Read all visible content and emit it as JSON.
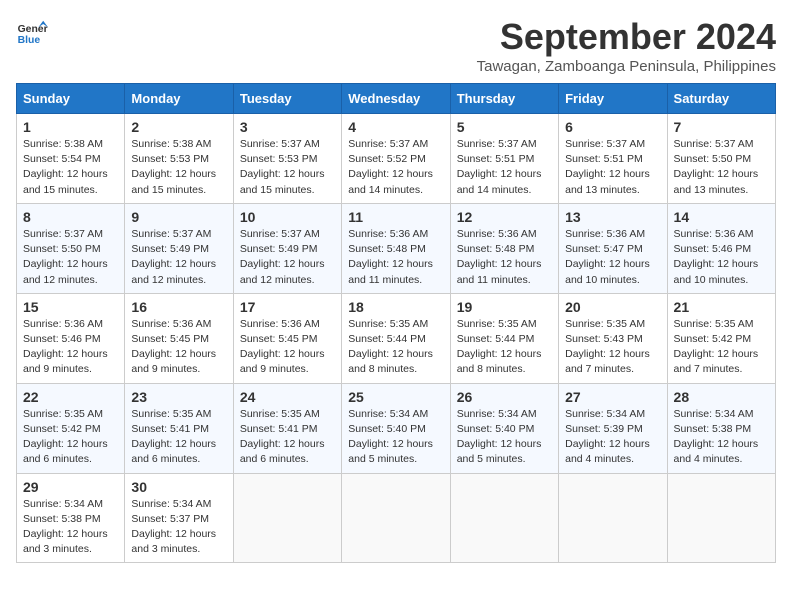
{
  "header": {
    "logo_line1": "General",
    "logo_line2": "Blue",
    "month_title": "September 2024",
    "subtitle": "Tawagan, Zamboanga Peninsula, Philippines"
  },
  "weekdays": [
    "Sunday",
    "Monday",
    "Tuesday",
    "Wednesday",
    "Thursday",
    "Friday",
    "Saturday"
  ],
  "weeks": [
    [
      {
        "day": "1",
        "sunrise": "5:38 AM",
        "sunset": "5:54 PM",
        "daylight": "12 hours and 15 minutes."
      },
      {
        "day": "2",
        "sunrise": "5:38 AM",
        "sunset": "5:53 PM",
        "daylight": "12 hours and 15 minutes."
      },
      {
        "day": "3",
        "sunrise": "5:37 AM",
        "sunset": "5:53 PM",
        "daylight": "12 hours and 15 minutes."
      },
      {
        "day": "4",
        "sunrise": "5:37 AM",
        "sunset": "5:52 PM",
        "daylight": "12 hours and 14 minutes."
      },
      {
        "day": "5",
        "sunrise": "5:37 AM",
        "sunset": "5:51 PM",
        "daylight": "12 hours and 14 minutes."
      },
      {
        "day": "6",
        "sunrise": "5:37 AM",
        "sunset": "5:51 PM",
        "daylight": "12 hours and 13 minutes."
      },
      {
        "day": "7",
        "sunrise": "5:37 AM",
        "sunset": "5:50 PM",
        "daylight": "12 hours and 13 minutes."
      }
    ],
    [
      {
        "day": "8",
        "sunrise": "5:37 AM",
        "sunset": "5:50 PM",
        "daylight": "12 hours and 12 minutes."
      },
      {
        "day": "9",
        "sunrise": "5:37 AM",
        "sunset": "5:49 PM",
        "daylight": "12 hours and 12 minutes."
      },
      {
        "day": "10",
        "sunrise": "5:37 AM",
        "sunset": "5:49 PM",
        "daylight": "12 hours and 12 minutes."
      },
      {
        "day": "11",
        "sunrise": "5:36 AM",
        "sunset": "5:48 PM",
        "daylight": "12 hours and 11 minutes."
      },
      {
        "day": "12",
        "sunrise": "5:36 AM",
        "sunset": "5:48 PM",
        "daylight": "12 hours and 11 minutes."
      },
      {
        "day": "13",
        "sunrise": "5:36 AM",
        "sunset": "5:47 PM",
        "daylight": "12 hours and 10 minutes."
      },
      {
        "day": "14",
        "sunrise": "5:36 AM",
        "sunset": "5:46 PM",
        "daylight": "12 hours and 10 minutes."
      }
    ],
    [
      {
        "day": "15",
        "sunrise": "5:36 AM",
        "sunset": "5:46 PM",
        "daylight": "12 hours and 9 minutes."
      },
      {
        "day": "16",
        "sunrise": "5:36 AM",
        "sunset": "5:45 PM",
        "daylight": "12 hours and 9 minutes."
      },
      {
        "day": "17",
        "sunrise": "5:36 AM",
        "sunset": "5:45 PM",
        "daylight": "12 hours and 9 minutes."
      },
      {
        "day": "18",
        "sunrise": "5:35 AM",
        "sunset": "5:44 PM",
        "daylight": "12 hours and 8 minutes."
      },
      {
        "day": "19",
        "sunrise": "5:35 AM",
        "sunset": "5:44 PM",
        "daylight": "12 hours and 8 minutes."
      },
      {
        "day": "20",
        "sunrise": "5:35 AM",
        "sunset": "5:43 PM",
        "daylight": "12 hours and 7 minutes."
      },
      {
        "day": "21",
        "sunrise": "5:35 AM",
        "sunset": "5:42 PM",
        "daylight": "12 hours and 7 minutes."
      }
    ],
    [
      {
        "day": "22",
        "sunrise": "5:35 AM",
        "sunset": "5:42 PM",
        "daylight": "12 hours and 6 minutes."
      },
      {
        "day": "23",
        "sunrise": "5:35 AM",
        "sunset": "5:41 PM",
        "daylight": "12 hours and 6 minutes."
      },
      {
        "day": "24",
        "sunrise": "5:35 AM",
        "sunset": "5:41 PM",
        "daylight": "12 hours and 6 minutes."
      },
      {
        "day": "25",
        "sunrise": "5:34 AM",
        "sunset": "5:40 PM",
        "daylight": "12 hours and 5 minutes."
      },
      {
        "day": "26",
        "sunrise": "5:34 AM",
        "sunset": "5:40 PM",
        "daylight": "12 hours and 5 minutes."
      },
      {
        "day": "27",
        "sunrise": "5:34 AM",
        "sunset": "5:39 PM",
        "daylight": "12 hours and 4 minutes."
      },
      {
        "day": "28",
        "sunrise": "5:34 AM",
        "sunset": "5:38 PM",
        "daylight": "12 hours and 4 minutes."
      }
    ],
    [
      {
        "day": "29",
        "sunrise": "5:34 AM",
        "sunset": "5:38 PM",
        "daylight": "12 hours and 3 minutes."
      },
      {
        "day": "30",
        "sunrise": "5:34 AM",
        "sunset": "5:37 PM",
        "daylight": "12 hours and 3 minutes."
      },
      null,
      null,
      null,
      null,
      null
    ]
  ]
}
